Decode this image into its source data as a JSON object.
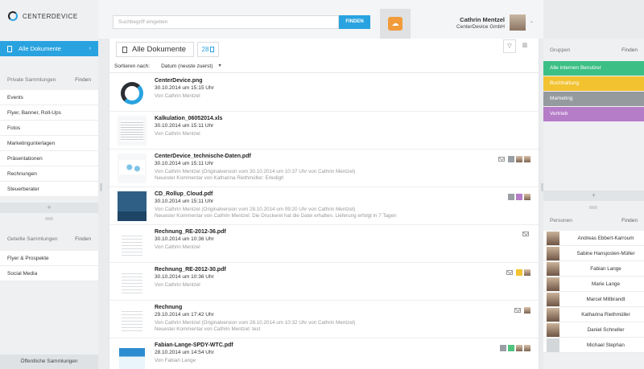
{
  "app": {
    "logo_text": "CENTERDEVICE"
  },
  "left": {
    "all_docs_label": "Alle Dokumente",
    "private": {
      "title": "Private Sammlungen",
      "find": "Finden",
      "items": [
        "Events",
        "Flyer, Banner, Roll-Ups",
        "Fotos",
        "Marketingunterlagen",
        "Präsentationen",
        "Rechnungen",
        "Steuerberater"
      ]
    },
    "shared": {
      "title": "Geteilte Sammlungen",
      "find": "Finden",
      "items": [
        "Flyer & Prospekte",
        "Social Media"
      ]
    },
    "add_symbol": "+",
    "public_label": "Öffentliche Sammlungen"
  },
  "top": {
    "search_placeholder": "Suchbegriff eingeben",
    "search_button": "FINDEN",
    "user_name": "Cathrin Mentzel",
    "user_company": "CenterDevice GmbH"
  },
  "main": {
    "title": "Alle Dokumente",
    "count": "28",
    "sort_label": "Sortieren nach:",
    "sort_value": "Datum (neuste zuerst)",
    "documents": [
      {
        "name": "CenterDevice.png",
        "date": "30.10.2014 um 15:15 Uhr",
        "meta": "Von Cathrin Mentzel",
        "comment": "",
        "thumb": "logo",
        "badges": []
      },
      {
        "name": "Kalkulation_06052014.xls",
        "date": "30.10.2014 um 15:11 Uhr",
        "meta": "Von Cathrin Mentzel",
        "comment": "",
        "thumb": "sheet",
        "badges": []
      },
      {
        "name": "CenterDevice_technische-Daten.pdf",
        "date": "30.10.2014 um 15:11 Uhr",
        "meta": "Von Cathrin Mentzel (Originalversion vom 30.10.2014 um 10:37 Uhr von Cathrin Mentzel)",
        "comment": "Neuester Kommentar von Katharina Riethmüller: Erledigt!",
        "thumb": "chart",
        "badges": [
          "mail",
          "#9a9fa5",
          "avatar",
          "avatar"
        ]
      },
      {
        "name": "CD_Rollup_Cloud.pdf",
        "date": "30.10.2014 um 15:11 Uhr",
        "meta": "Von Cathrin Mentzel (Originalversion vom 28.10.2014 um 09:20 Uhr von Cathrin Mentzel)",
        "comment": "Neuester Kommentar von Cathrin Mentzel: Die Druckerei hat die Datei erhalten. Lieferung erfolgt in 7 Tagen",
        "thumb": "photo",
        "badges": [
          "#9a9fa5",
          "#b57cc8",
          "avatar"
        ]
      },
      {
        "name": "Rechnung_RE-2012-36.pdf",
        "date": "30.10.2014 um 10:36 Uhr",
        "meta": "Von Cathrin Mentzel",
        "comment": "",
        "thumb": "invoice",
        "badges": [
          "mail"
        ]
      },
      {
        "name": "Rechnung_RE-2012-30.pdf",
        "date": "30.10.2014 um 10:36 Uhr",
        "meta": "Von Cathrin Mentzel",
        "comment": "",
        "thumb": "invoice",
        "badges": [
          "mail",
          "#f2c231",
          "avatar"
        ]
      },
      {
        "name": "Rechnung",
        "date": "29.10.2014 um 17:42 Uhr",
        "meta": "Von Cathrin Mentzel (Originalversion vom 28.10.2014 um 10:32 Uhr von Cathrin Mentzel)",
        "comment": "Neuester Kommentar von Cathrin Mentzel: test",
        "thumb": "invoice",
        "badges": [
          "mail",
          "avatar"
        ]
      },
      {
        "name": "Fabian-Lange-SPDY-WTC.pdf",
        "date": "28.10.2014 um 14:54 Uhr",
        "meta": "Von Fabian Lange",
        "comment": "",
        "thumb": "slide",
        "badges": [
          "#9a9fa5",
          "#4fc37e",
          "avatar",
          "avatar"
        ]
      }
    ]
  },
  "right": {
    "groups_title": "Gruppen",
    "groups_find": "Finden",
    "groups": [
      {
        "label": "Alle internen Benutzer",
        "color": "#3cbf84"
      },
      {
        "label": "Buchhaltung",
        "color": "#f2c231"
      },
      {
        "label": "Marketing",
        "color": "#959a9f"
      },
      {
        "label": "Vertrieb",
        "color": "#b57cc8"
      }
    ],
    "add_symbol": "+",
    "persons_title": "Personen",
    "persons_find": "Finden",
    "persons": [
      "Andreas Ebbert-Karroum",
      "Sabine Hansjosten-Müller",
      "Fabian Lange",
      "Marie Lange",
      "Marcel Millbrandt",
      "Katharina Riethmüller",
      "Daniel Schneller",
      "Michael Stephan"
    ]
  }
}
